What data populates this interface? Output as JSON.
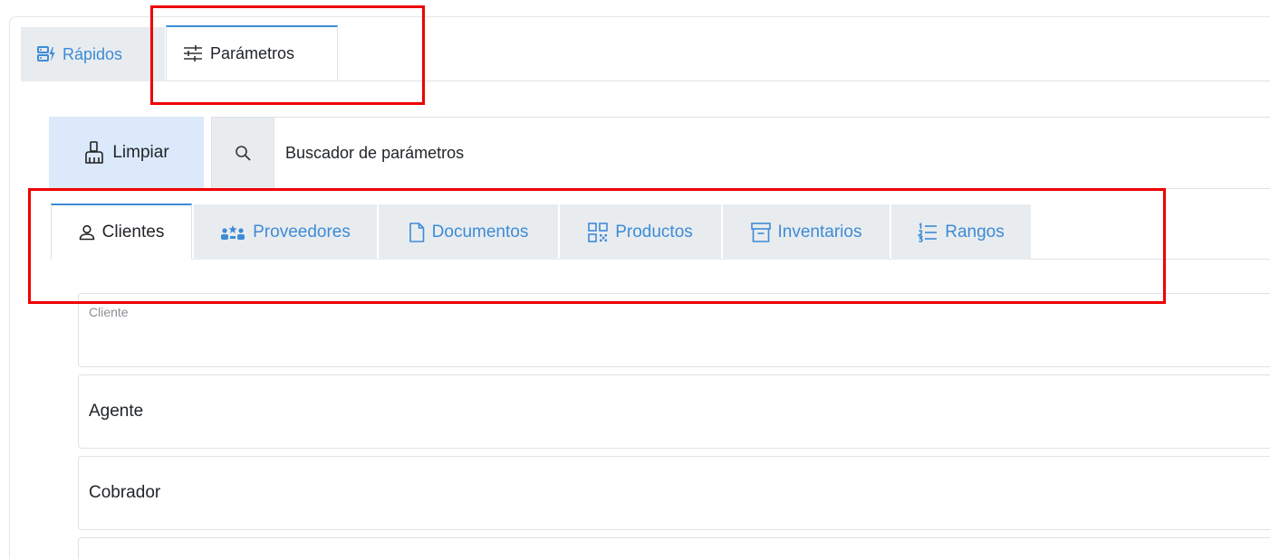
{
  "top_tabs": [
    {
      "label": "Rápidos",
      "icon": "quick-access-icon",
      "active": false
    },
    {
      "label": "Parámetros",
      "icon": "sliders-icon",
      "active": true
    }
  ],
  "toolbar": {
    "clear_label": "Limpiar",
    "clear_icon": "broom-icon"
  },
  "search": {
    "icon": "search-icon",
    "placeholder": "Buscador de parámetros"
  },
  "param_tabs": [
    {
      "label": "Clientes",
      "icon": "user-icon",
      "active": true
    },
    {
      "label": "Proveedores",
      "icon": "providers-icon",
      "active": false
    },
    {
      "label": "Documentos",
      "icon": "document-icon",
      "active": false
    },
    {
      "label": "Productos",
      "icon": "qr-icon",
      "active": false
    },
    {
      "label": "Inventarios",
      "icon": "archive-icon",
      "active": false
    },
    {
      "label": "Rangos",
      "icon": "list-ordered-icon",
      "active": false
    }
  ],
  "fields": [
    {
      "label": "Cliente"
    },
    {
      "label": "Agente"
    },
    {
      "label": "Cobrador"
    },
    {
      "label": ""
    }
  ],
  "colors": {
    "accent": "#3d8bd6",
    "highlight": "#ee0000",
    "clear_button_bg": "#dbe9fb",
    "inactive_tab_bg": "#e9ecef"
  }
}
